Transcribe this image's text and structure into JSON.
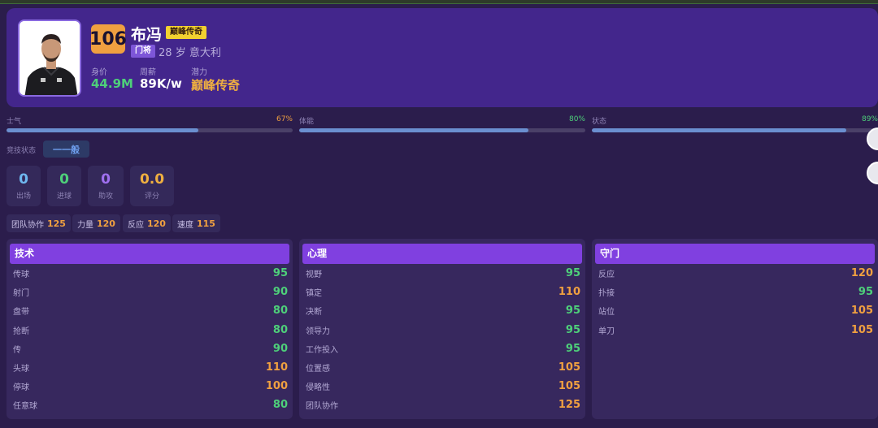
{
  "player": {
    "rating": "106",
    "name": "布冯",
    "tier_badge": "巅峰传奇",
    "position": "门将",
    "age": "28",
    "age_unit": "岁",
    "nationality": "意大利"
  },
  "meta": {
    "value_label": "身价",
    "value": "44.9M",
    "wage_label": "周薪",
    "wage": "89K/w",
    "potential_label": "潜力",
    "potential": "巅峰传奇"
  },
  "bars": [
    {
      "label": "士气",
      "pct_text": "67%",
      "fraction": 0.67,
      "color": "#f0a040"
    },
    {
      "label": "体能",
      "pct_text": "80%",
      "fraction": 0.8,
      "color": "#4ed07a"
    },
    {
      "label": "状态",
      "pct_text": "89%",
      "fraction": 0.89,
      "color": "#4ed07a"
    }
  ],
  "status": {
    "label": "竞技状态",
    "value": "一一般"
  },
  "stats": [
    {
      "value": "0",
      "label": "出场",
      "color": "#6fb8f0"
    },
    {
      "value": "0",
      "label": "进球",
      "color": "#4ed07a"
    },
    {
      "value": "0",
      "label": "助攻",
      "color": "#a070f0"
    },
    {
      "value": "0.0",
      "label": "评分",
      "color": "#f0b040"
    }
  ],
  "chips": [
    {
      "label": "团队协作",
      "value": "125"
    },
    {
      "label": "力量",
      "value": "120"
    },
    {
      "label": "反应",
      "value": "120"
    },
    {
      "label": "速度",
      "value": "115"
    }
  ],
  "panels": [
    {
      "title": "技术",
      "rows": [
        {
          "label": "传球",
          "value": "95",
          "tone": "green"
        },
        {
          "label": "射门",
          "value": "90",
          "tone": "green"
        },
        {
          "label": "盘带",
          "value": "80",
          "tone": "green"
        },
        {
          "label": "抢断",
          "value": "80",
          "tone": "green"
        },
        {
          "label": "传",
          "value": "90",
          "tone": "green"
        },
        {
          "label": "头球",
          "value": "110",
          "tone": "orange"
        },
        {
          "label": "停球",
          "value": "100",
          "tone": "orange"
        },
        {
          "label": "任意球",
          "value": "80",
          "tone": "green"
        }
      ]
    },
    {
      "title": "心理",
      "rows": [
        {
          "label": "视野",
          "value": "95",
          "tone": "green"
        },
        {
          "label": "镇定",
          "value": "110",
          "tone": "orange"
        },
        {
          "label": "决断",
          "value": "95",
          "tone": "green"
        },
        {
          "label": "领导力",
          "value": "95",
          "tone": "green"
        },
        {
          "label": "工作投入",
          "value": "95",
          "tone": "green"
        },
        {
          "label": "位置感",
          "value": "105",
          "tone": "orange"
        },
        {
          "label": "侵略性",
          "value": "105",
          "tone": "orange"
        },
        {
          "label": "团队协作",
          "value": "125",
          "tone": "orange"
        }
      ]
    },
    {
      "title": "守门",
      "rows": [
        {
          "label": "反应",
          "value": "120",
          "tone": "orange"
        },
        {
          "label": "扑接",
          "value": "95",
          "tone": "green"
        },
        {
          "label": "站位",
          "value": "105",
          "tone": "orange"
        },
        {
          "label": "单刀",
          "value": "105",
          "tone": "orange"
        }
      ]
    }
  ],
  "icons": {
    "portrait": "player-portrait-icon"
  },
  "colors": {
    "background": "#2b1d4c",
    "header_card": "#43268c",
    "panel_header": "#8040e0",
    "good": "#4ed07a",
    "high": "#f0a040"
  }
}
